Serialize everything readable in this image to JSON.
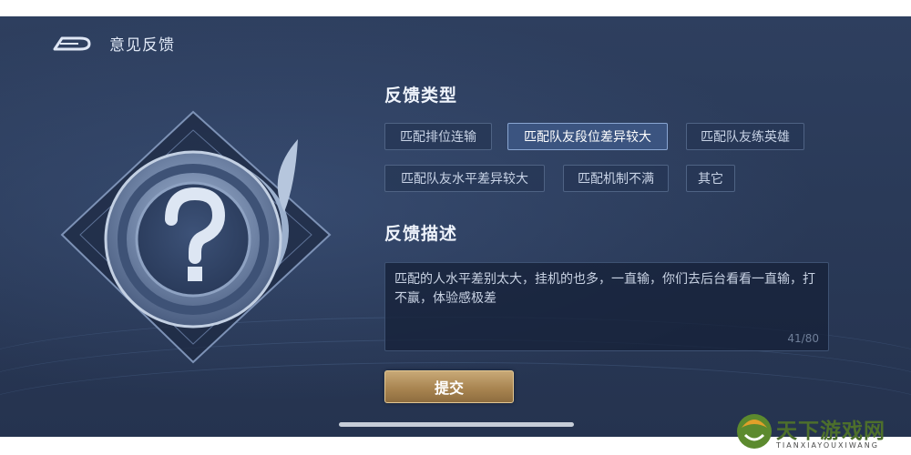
{
  "header": {
    "title": "意见反馈"
  },
  "feedback_type": {
    "title": "反馈类型",
    "selected": "匹配队友段位差异较大",
    "options": [
      "匹配排位连输",
      "匹配队友段位差异较大",
      "匹配队友练英雄",
      "匹配队友水平差异较大",
      "匹配机制不满",
      "其它"
    ]
  },
  "feedback_desc": {
    "title": "反馈描述",
    "text": "匹配的人水平差别太大，挂机的也多，一直输，你们去后台看看一直输，打不赢，体验感极差",
    "counter": "41/80"
  },
  "submit": {
    "label": "提交"
  },
  "watermark": {
    "name": "天下游戏网",
    "sub": "TIANXIAYOUXIWANG"
  },
  "colors": {
    "background": "#2a3a58",
    "selected": "#3b5480",
    "submit": "#a98551"
  },
  "icons": {
    "back": "back-arrow-icon",
    "emblem": "question-mark-emblem-icon"
  }
}
